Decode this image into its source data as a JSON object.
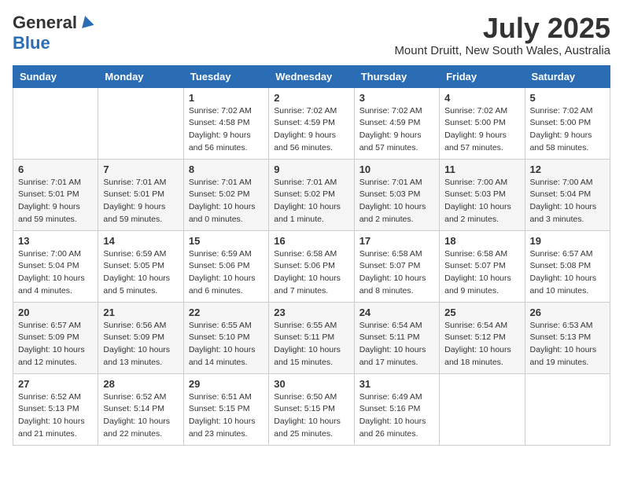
{
  "header": {
    "logo_general": "General",
    "logo_blue": "Blue",
    "month_title": "July 2025",
    "subtitle": "Mount Druitt, New South Wales, Australia"
  },
  "days_of_week": [
    "Sunday",
    "Monday",
    "Tuesday",
    "Wednesday",
    "Thursday",
    "Friday",
    "Saturday"
  ],
  "weeks": [
    [
      {
        "day": "",
        "info": ""
      },
      {
        "day": "",
        "info": ""
      },
      {
        "day": "1",
        "info": "Sunrise: 7:02 AM\nSunset: 4:58 PM\nDaylight: 9 hours and 56 minutes."
      },
      {
        "day": "2",
        "info": "Sunrise: 7:02 AM\nSunset: 4:59 PM\nDaylight: 9 hours and 56 minutes."
      },
      {
        "day": "3",
        "info": "Sunrise: 7:02 AM\nSunset: 4:59 PM\nDaylight: 9 hours and 57 minutes."
      },
      {
        "day": "4",
        "info": "Sunrise: 7:02 AM\nSunset: 5:00 PM\nDaylight: 9 hours and 57 minutes."
      },
      {
        "day": "5",
        "info": "Sunrise: 7:02 AM\nSunset: 5:00 PM\nDaylight: 9 hours and 58 minutes."
      }
    ],
    [
      {
        "day": "6",
        "info": "Sunrise: 7:01 AM\nSunset: 5:01 PM\nDaylight: 9 hours and 59 minutes."
      },
      {
        "day": "7",
        "info": "Sunrise: 7:01 AM\nSunset: 5:01 PM\nDaylight: 9 hours and 59 minutes."
      },
      {
        "day": "8",
        "info": "Sunrise: 7:01 AM\nSunset: 5:02 PM\nDaylight: 10 hours and 0 minutes."
      },
      {
        "day": "9",
        "info": "Sunrise: 7:01 AM\nSunset: 5:02 PM\nDaylight: 10 hours and 1 minute."
      },
      {
        "day": "10",
        "info": "Sunrise: 7:01 AM\nSunset: 5:03 PM\nDaylight: 10 hours and 2 minutes."
      },
      {
        "day": "11",
        "info": "Sunrise: 7:00 AM\nSunset: 5:03 PM\nDaylight: 10 hours and 2 minutes."
      },
      {
        "day": "12",
        "info": "Sunrise: 7:00 AM\nSunset: 5:04 PM\nDaylight: 10 hours and 3 minutes."
      }
    ],
    [
      {
        "day": "13",
        "info": "Sunrise: 7:00 AM\nSunset: 5:04 PM\nDaylight: 10 hours and 4 minutes."
      },
      {
        "day": "14",
        "info": "Sunrise: 6:59 AM\nSunset: 5:05 PM\nDaylight: 10 hours and 5 minutes."
      },
      {
        "day": "15",
        "info": "Sunrise: 6:59 AM\nSunset: 5:06 PM\nDaylight: 10 hours and 6 minutes."
      },
      {
        "day": "16",
        "info": "Sunrise: 6:58 AM\nSunset: 5:06 PM\nDaylight: 10 hours and 7 minutes."
      },
      {
        "day": "17",
        "info": "Sunrise: 6:58 AM\nSunset: 5:07 PM\nDaylight: 10 hours and 8 minutes."
      },
      {
        "day": "18",
        "info": "Sunrise: 6:58 AM\nSunset: 5:07 PM\nDaylight: 10 hours and 9 minutes."
      },
      {
        "day": "19",
        "info": "Sunrise: 6:57 AM\nSunset: 5:08 PM\nDaylight: 10 hours and 10 minutes."
      }
    ],
    [
      {
        "day": "20",
        "info": "Sunrise: 6:57 AM\nSunset: 5:09 PM\nDaylight: 10 hours and 12 minutes."
      },
      {
        "day": "21",
        "info": "Sunrise: 6:56 AM\nSunset: 5:09 PM\nDaylight: 10 hours and 13 minutes."
      },
      {
        "day": "22",
        "info": "Sunrise: 6:55 AM\nSunset: 5:10 PM\nDaylight: 10 hours and 14 minutes."
      },
      {
        "day": "23",
        "info": "Sunrise: 6:55 AM\nSunset: 5:11 PM\nDaylight: 10 hours and 15 minutes."
      },
      {
        "day": "24",
        "info": "Sunrise: 6:54 AM\nSunset: 5:11 PM\nDaylight: 10 hours and 17 minutes."
      },
      {
        "day": "25",
        "info": "Sunrise: 6:54 AM\nSunset: 5:12 PM\nDaylight: 10 hours and 18 minutes."
      },
      {
        "day": "26",
        "info": "Sunrise: 6:53 AM\nSunset: 5:13 PM\nDaylight: 10 hours and 19 minutes."
      }
    ],
    [
      {
        "day": "27",
        "info": "Sunrise: 6:52 AM\nSunset: 5:13 PM\nDaylight: 10 hours and 21 minutes."
      },
      {
        "day": "28",
        "info": "Sunrise: 6:52 AM\nSunset: 5:14 PM\nDaylight: 10 hours and 22 minutes."
      },
      {
        "day": "29",
        "info": "Sunrise: 6:51 AM\nSunset: 5:15 PM\nDaylight: 10 hours and 23 minutes."
      },
      {
        "day": "30",
        "info": "Sunrise: 6:50 AM\nSunset: 5:15 PM\nDaylight: 10 hours and 25 minutes."
      },
      {
        "day": "31",
        "info": "Sunrise: 6:49 AM\nSunset: 5:16 PM\nDaylight: 10 hours and 26 minutes."
      },
      {
        "day": "",
        "info": ""
      },
      {
        "day": "",
        "info": ""
      }
    ]
  ]
}
